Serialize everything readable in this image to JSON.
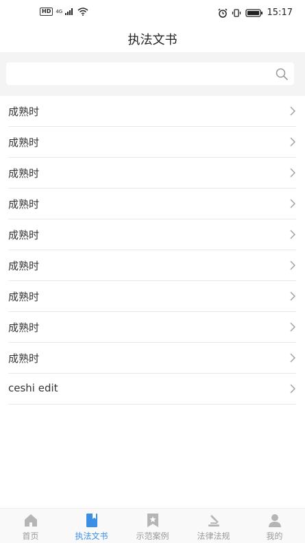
{
  "status_bar": {
    "network": "4G",
    "hd": "HD",
    "time": "15:17"
  },
  "header": {
    "title": "执法文书"
  },
  "search": {
    "placeholder": ""
  },
  "list": {
    "items": [
      {
        "label": "成熟时"
      },
      {
        "label": "成熟时"
      },
      {
        "label": "成熟时"
      },
      {
        "label": "成熟时"
      },
      {
        "label": "成熟时"
      },
      {
        "label": "成熟时"
      },
      {
        "label": "成熟时"
      },
      {
        "label": "成熟时"
      },
      {
        "label": "成熟时"
      },
      {
        "label": "ceshi edit"
      }
    ]
  },
  "tab_bar": {
    "active_color": "#3a8ee6",
    "inactive_color": "#9a9a9a",
    "tabs": [
      {
        "label": "首页",
        "icon": "home-icon",
        "active": false
      },
      {
        "label": "执法文书",
        "icon": "bookmark-book-icon",
        "active": true
      },
      {
        "label": "示范案例",
        "icon": "star-badge-icon",
        "active": false
      },
      {
        "label": "法律法规",
        "icon": "gavel-icon",
        "active": false
      },
      {
        "label": "我的",
        "icon": "user-icon",
        "active": false
      }
    ]
  }
}
